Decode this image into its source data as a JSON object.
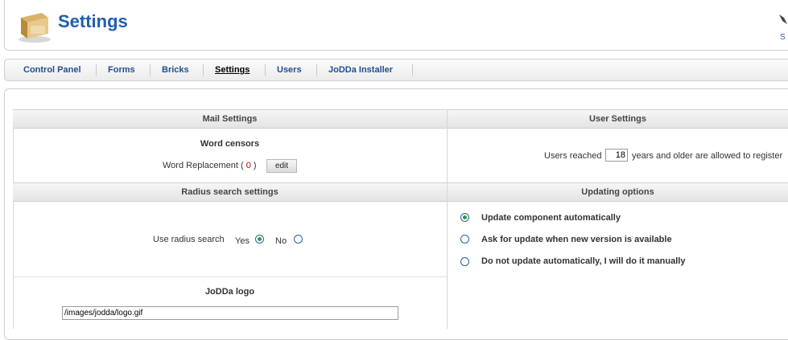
{
  "header": {
    "title": "Settings",
    "icon": "settings-box-icon",
    "corner_text": "S"
  },
  "nav": {
    "items": [
      {
        "label": "Control Panel"
      },
      {
        "label": "Forms"
      },
      {
        "label": "Bricks"
      },
      {
        "label": "Settings",
        "active": true
      },
      {
        "label": "Users"
      },
      {
        "label": "JoDDa Installer"
      }
    ]
  },
  "mail": {
    "heading": "Mail Settings",
    "censors_title": "Word censors",
    "replacement_label": "Word Replacement (",
    "replacement_count": "0",
    "replacement_close": ")",
    "edit_label": "edit"
  },
  "user": {
    "heading": "User Settings",
    "age_prefix": "Users reached",
    "age_value": "18",
    "age_suffix": "years and older are allowed to register"
  },
  "radius": {
    "heading": "Radius search settings",
    "label": "Use radius search",
    "yes_label": "Yes",
    "no_label": "No",
    "selected": "Yes"
  },
  "updating": {
    "heading": "Updating options",
    "options": [
      {
        "label": "Update component automatically",
        "checked": true
      },
      {
        "label": "Ask for update when new version is available",
        "checked": false
      },
      {
        "label": "Do not update automatically, I will do it manually",
        "checked": false
      }
    ]
  },
  "logo": {
    "title": "JoDDa logo",
    "path": "/images/jodda/logo.gif"
  },
  "colors": {
    "title_blue": "#1f5fb0",
    "nav_link": "#1f4f8f",
    "radio_dot": "#2f9d3a",
    "count_red": "#c00000"
  }
}
